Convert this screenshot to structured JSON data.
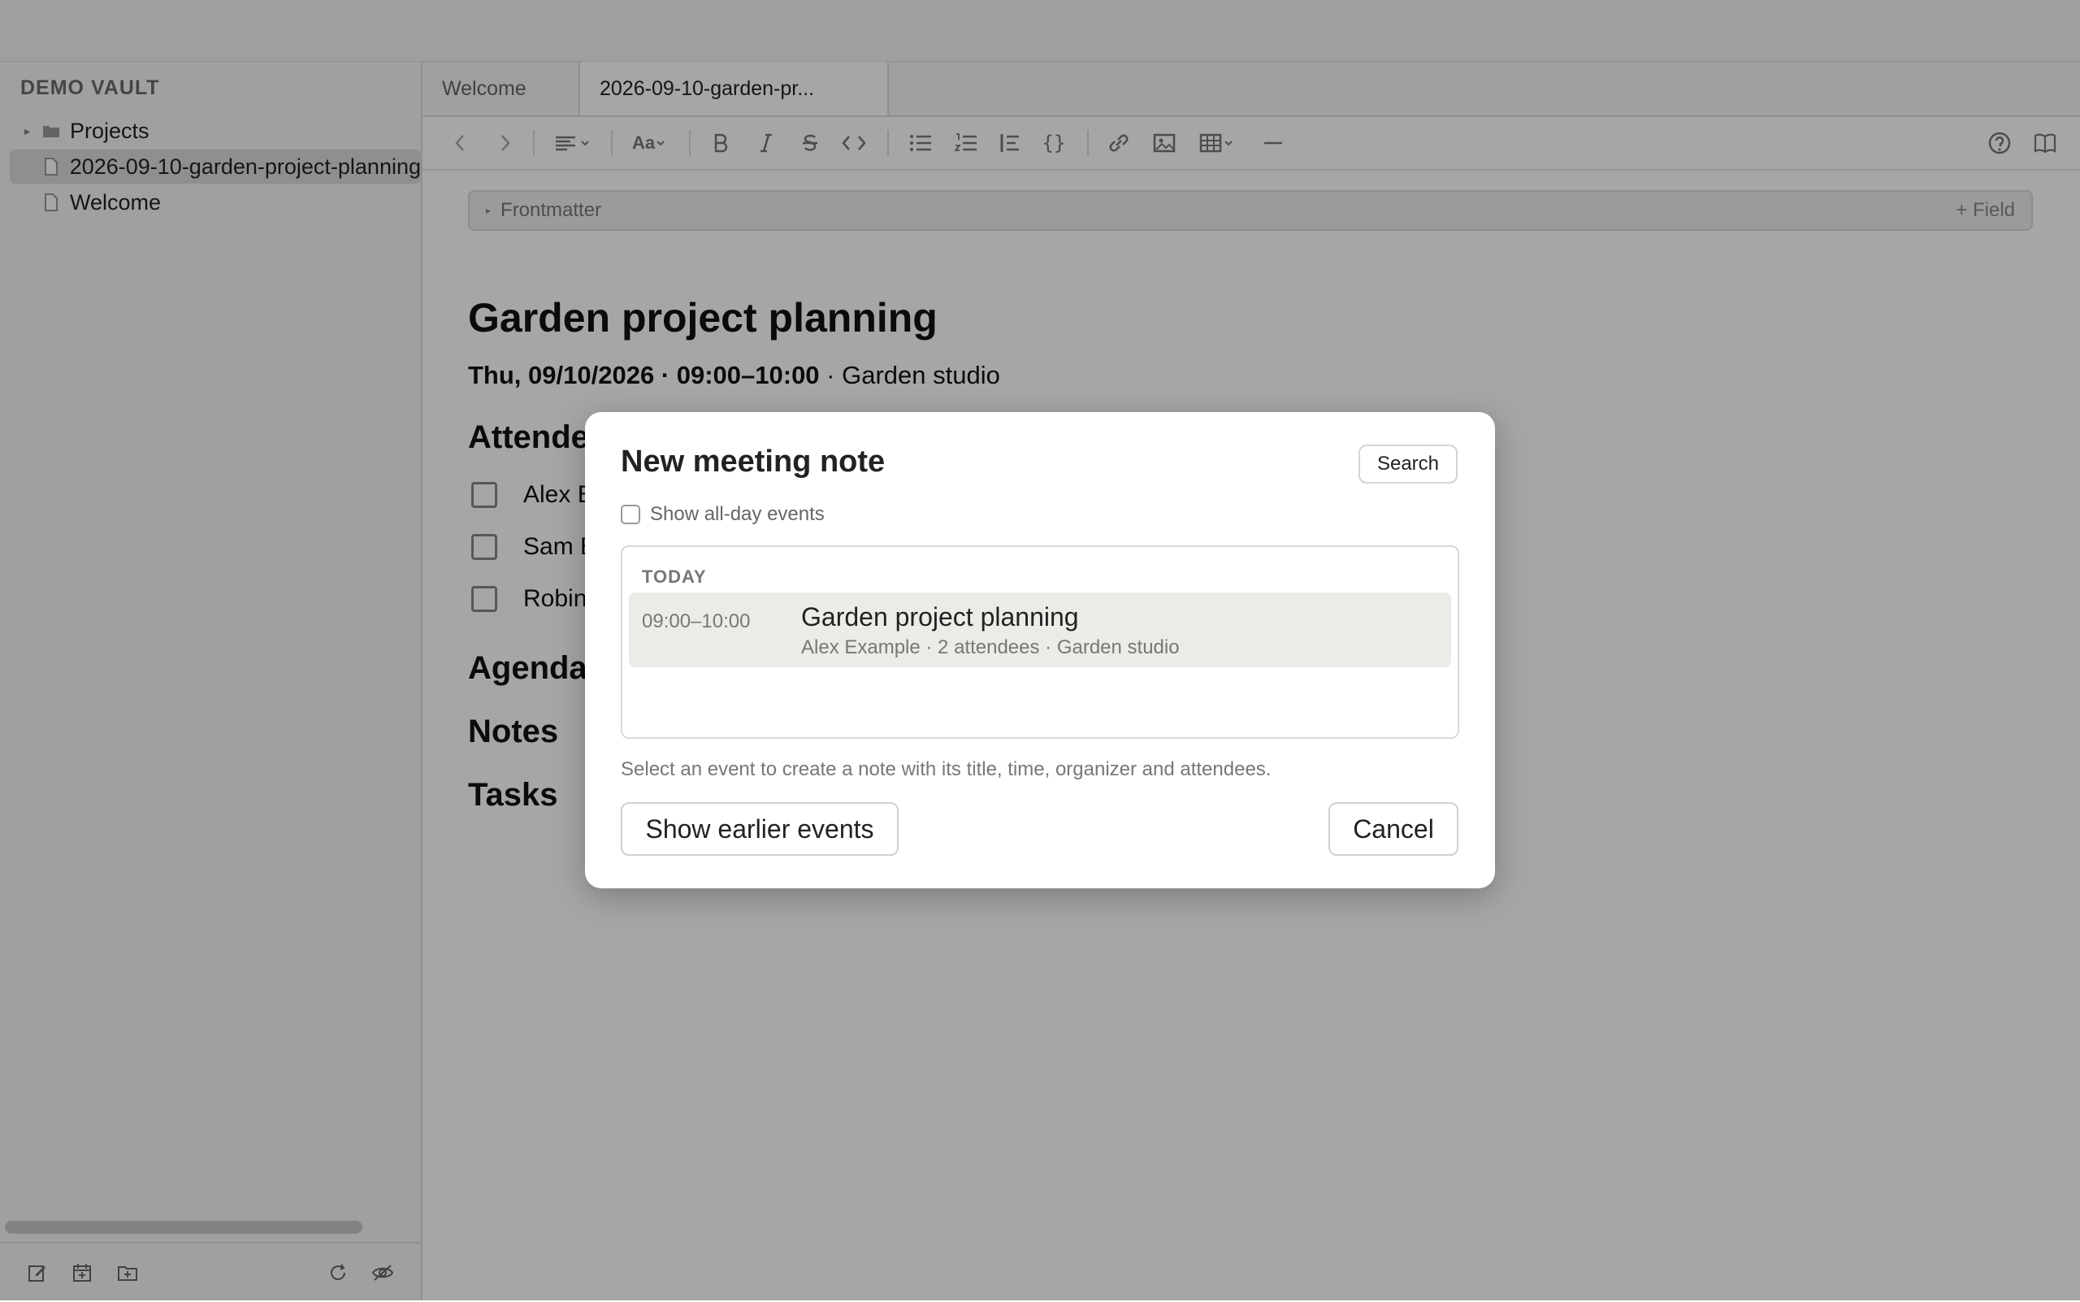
{
  "sidebar": {
    "vault_name": "DEMO VAULT",
    "items": [
      {
        "label": "Projects",
        "icon": "folder-icon"
      },
      {
        "label": "2026-09-10-garden-project-planning",
        "icon": "file-icon"
      },
      {
        "label": "Welcome",
        "icon": "file-icon"
      }
    ],
    "footer_icons": [
      "new-note-icon",
      "calendar-plus-icon",
      "new-folder-icon",
      "refresh-icon",
      "eye-off-icon"
    ]
  },
  "tabs": [
    {
      "label": "Welcome"
    },
    {
      "label": "2026-09-10-garden-pr..."
    }
  ],
  "toolbar": {
    "font_label": "Aa",
    "code_block_label": "{}"
  },
  "editor": {
    "frontmatter_label": "Frontmatter",
    "add_field_label": "+ Field",
    "title": "Garden project planning",
    "meta_bold": "Thu, 09/10/2026 · 09:00–10:00",
    "meta_rest": " · Garden studio",
    "attendees_heading": "Attendees",
    "attendees": [
      "Alex E",
      "Sam E",
      "Robin"
    ],
    "agenda_heading": "Agenda",
    "notes_heading": "Notes",
    "tasks_heading": "Tasks"
  },
  "modal": {
    "title": "New meeting note",
    "search_label": "Search",
    "allday_label": "Show all-day events",
    "day_label": "TODAY",
    "event": {
      "time": "09:00–10:00",
      "title": "Garden project planning",
      "subtitle": "Alex Example · 2 attendees · Garden studio"
    },
    "hint": "Select an event to create a note with its title, time, organizer and attendees.",
    "earlier_label": "Show earlier events",
    "cancel_label": "Cancel"
  }
}
